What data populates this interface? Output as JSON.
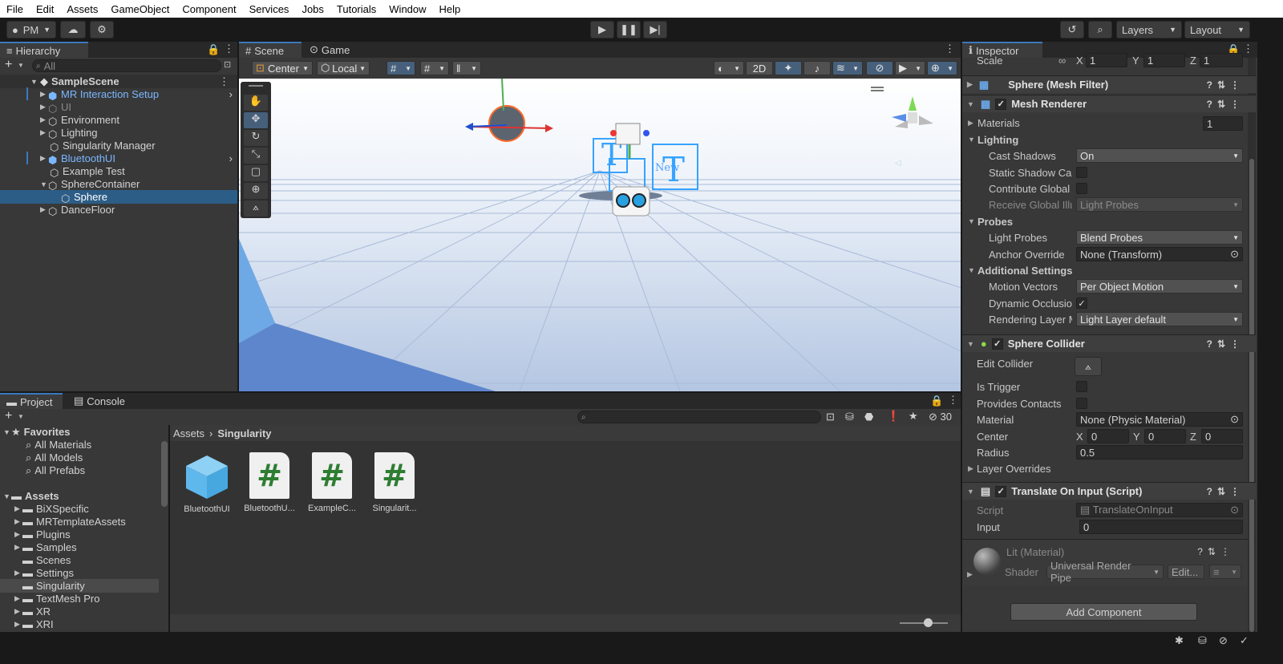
{
  "menu": [
    "File",
    "Edit",
    "Assets",
    "GameObject",
    "Component",
    "Services",
    "Jobs",
    "Tutorials",
    "Window",
    "Help"
  ],
  "toolbar": {
    "account": "PM",
    "layers": "Layers",
    "layout": "Layout"
  },
  "hierarchy": {
    "tab": "Hierarchy",
    "search_placeholder": "All",
    "scene": "SampleScene",
    "items": [
      {
        "label": "MR Interaction Setup",
        "style": "prefab"
      },
      {
        "label": "UI",
        "style": "dim"
      },
      {
        "label": "Environment",
        "style": "normal"
      },
      {
        "label": "Lighting",
        "style": "normal"
      },
      {
        "label": "Singularity Manager",
        "style": "normal"
      },
      {
        "label": "BluetoothUI",
        "style": "prefab"
      },
      {
        "label": "Example Test",
        "style": "normal"
      },
      {
        "label": "SphereContainer",
        "style": "normal"
      },
      {
        "label": "Sphere",
        "style": "selected"
      },
      {
        "label": "DanceFloor",
        "style": "normal"
      }
    ]
  },
  "scene": {
    "tab_scene": "Scene",
    "tab_game": "Game",
    "pivot": "Center",
    "space": "Local",
    "mode_2d": "2D",
    "text_label": "New"
  },
  "project": {
    "tab_project": "Project",
    "tab_console": "Console",
    "hidden_count": "30",
    "favorites_label": "Favorites",
    "favorites": [
      "All Materials",
      "All Models",
      "All Prefabs"
    ],
    "assets_label": "Assets",
    "folders": [
      "BiXSpecific",
      "MRTemplateAssets",
      "Plugins",
      "Samples",
      "Scenes",
      "Settings",
      "Singularity",
      "TextMesh Pro",
      "XR",
      "XRI"
    ],
    "breadcrumb": [
      "Assets",
      "Singularity"
    ],
    "files": [
      {
        "name": "BluetoothUI",
        "kind": "prefab"
      },
      {
        "name": "BluetoothU...",
        "kind": "script"
      },
      {
        "name": "ExampleC...",
        "kind": "script"
      },
      {
        "name": "Singularit...",
        "kind": "script"
      }
    ]
  },
  "inspector": {
    "tab": "Inspector",
    "scale": {
      "label": "Scale",
      "x": "1",
      "y": "1",
      "z": "1"
    },
    "mesh_filter": "Sphere (Mesh Filter)",
    "mesh_renderer": "Mesh Renderer",
    "materials_label": "Materials",
    "materials_count": "1",
    "lighting_label": "Lighting",
    "cast_shadows": {
      "label": "Cast Shadows",
      "value": "On"
    },
    "static_shadow": "Static Shadow Ca",
    "contribute_gi": "Contribute Global",
    "receive_gi": {
      "label": "Receive Global Illu",
      "value": "Light Probes"
    },
    "probes_label": "Probes",
    "light_probes": {
      "label": "Light Probes",
      "value": "Blend Probes"
    },
    "anchor_override": {
      "label": "Anchor Override",
      "value": "None (Transform)"
    },
    "additional_label": "Additional Settings",
    "motion_vectors": {
      "label": "Motion Vectors",
      "value": "Per Object Motion"
    },
    "dynamic_occlusion": "Dynamic Occlusio",
    "rendering_layer": {
      "label": "Rendering Layer M",
      "value": "Light Layer default"
    },
    "sphere_collider": "Sphere Collider",
    "edit_collider": "Edit Collider",
    "is_trigger": "Is Trigger",
    "provides_contacts": "Provides Contacts",
    "material": {
      "label": "Material",
      "value": "None (Physic Material)"
    },
    "center": {
      "label": "Center",
      "x": "0",
      "y": "0",
      "z": "0"
    },
    "radius": {
      "label": "Radius",
      "value": "0.5"
    },
    "layer_overrides": "Layer Overrides",
    "script_comp": "Translate On Input (Script)",
    "script": {
      "label": "Script",
      "value": "TranslateOnInput"
    },
    "input": {
      "label": "Input",
      "value": "0"
    },
    "lit_material": "Lit (Material)",
    "shader": {
      "label": "Shader",
      "value": "Universal Render Pipe",
      "edit": "Edit..."
    },
    "add_component": "Add Component",
    "axis": {
      "x": "X",
      "y": "Y",
      "z": "Z"
    }
  }
}
